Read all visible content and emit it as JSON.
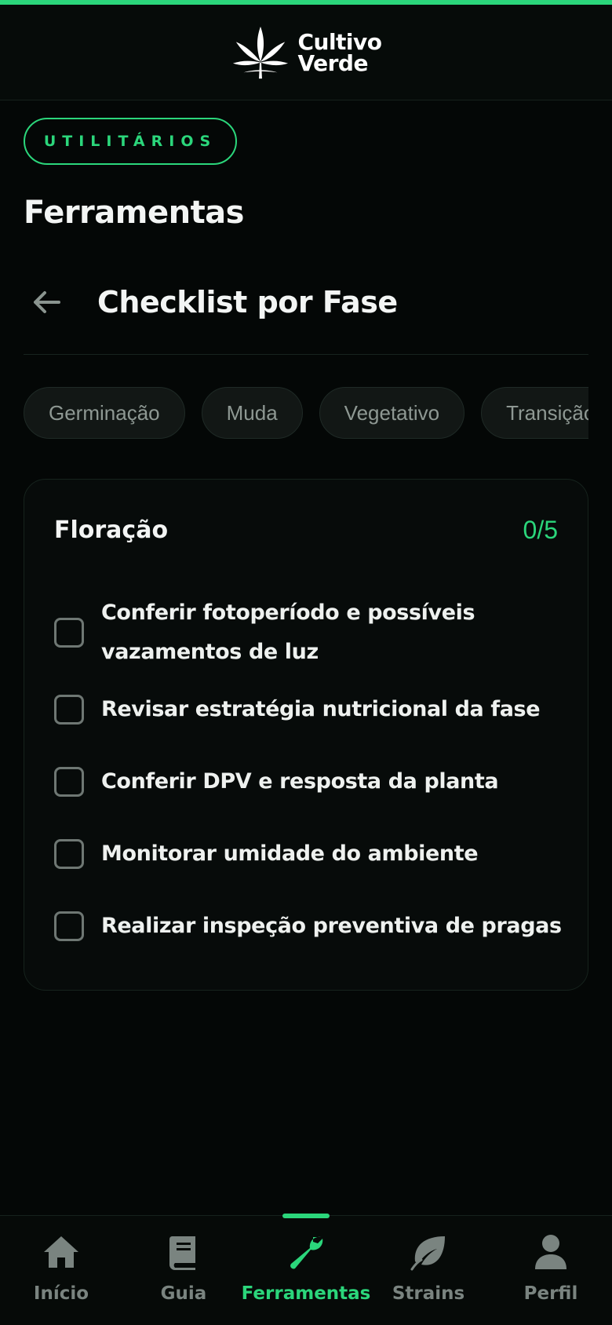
{
  "colors": {
    "accent": "#2bd67b",
    "background": "#040706",
    "muted_text": "#7a8480"
  },
  "header": {
    "logo_line1": "Cultivo",
    "logo_line2": "Verde",
    "logo_icon": "cannabis-leaf-icon"
  },
  "section": {
    "badge": "UTILITÁRIOS",
    "title": "Ferramentas"
  },
  "tool": {
    "back_icon": "arrow-left-icon",
    "title": "Checklist por Fase"
  },
  "phases": [
    {
      "label": "Germinação"
    },
    {
      "label": "Muda"
    },
    {
      "label": "Vegetativo"
    },
    {
      "label": "Transição"
    }
  ],
  "checklist": {
    "title": "Floração",
    "progress": "0/5",
    "items": [
      {
        "label": "Conferir fotoperíodo e possíveis vazamentos de luz",
        "checked": false
      },
      {
        "label": "Revisar estratégia nutricional da fase",
        "checked": false
      },
      {
        "label": "Conferir DPV e resposta da planta",
        "checked": false
      },
      {
        "label": "Monitorar umidade do ambiente",
        "checked": false
      },
      {
        "label": "Realizar inspeção preventiva de pragas",
        "checked": false
      }
    ]
  },
  "nav": {
    "active": "Ferramentas",
    "items": [
      {
        "label": "Início",
        "icon": "home-icon"
      },
      {
        "label": "Guia",
        "icon": "book-icon"
      },
      {
        "label": "Ferramentas",
        "icon": "wrench-icon"
      },
      {
        "label": "Strains",
        "icon": "leaf-icon"
      },
      {
        "label": "Perfil",
        "icon": "user-icon"
      }
    ]
  }
}
